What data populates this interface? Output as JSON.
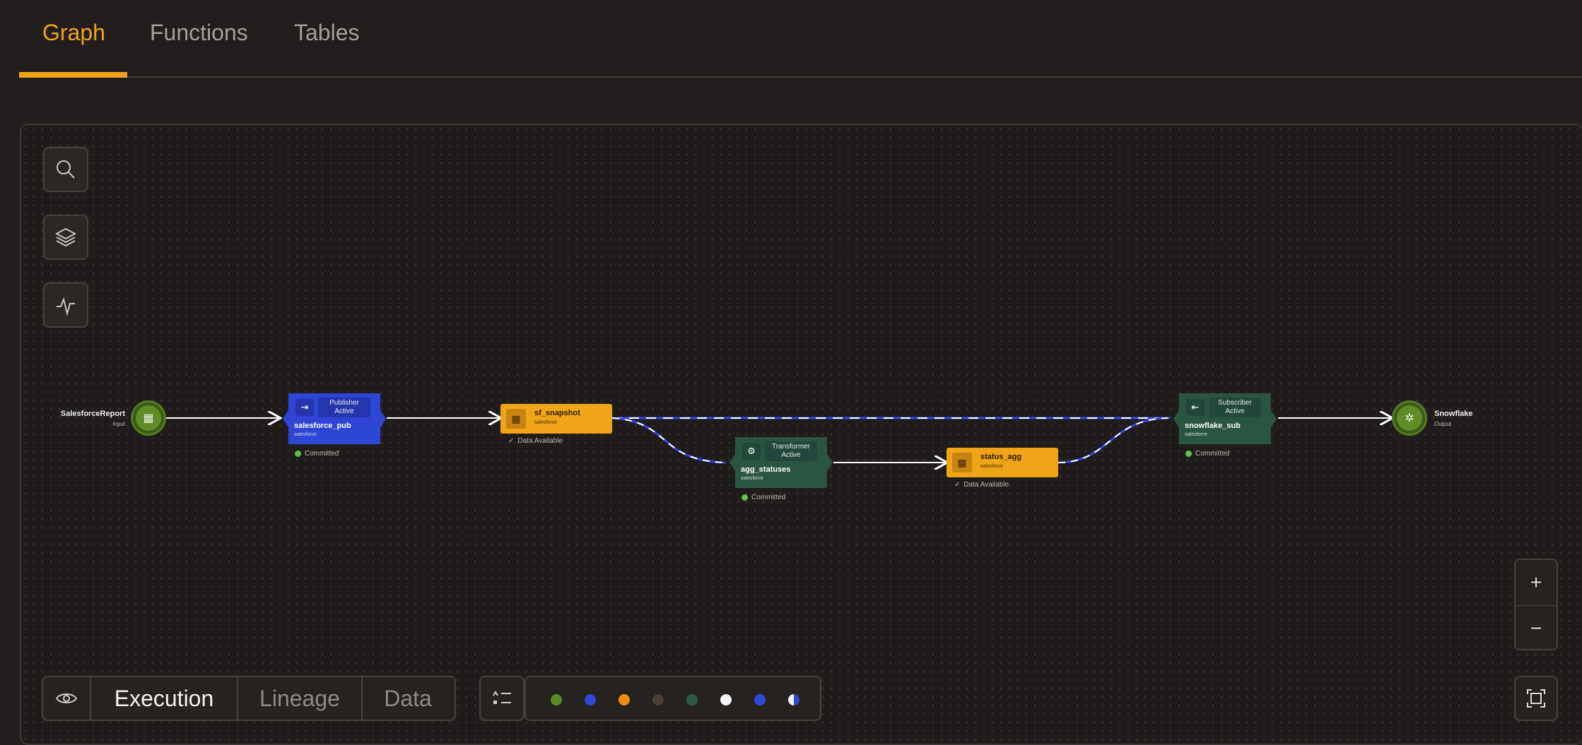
{
  "tabs": [
    {
      "label": "Graph",
      "active": true
    },
    {
      "label": "Functions",
      "active": false
    },
    {
      "label": "Tables",
      "active": false
    }
  ],
  "toolbar": {
    "icons": [
      "search-icon",
      "layers-icon",
      "activity-icon"
    ]
  },
  "graph": {
    "source": {
      "label": "SalesforceReport",
      "sub": "Input",
      "icon": "building-icon"
    },
    "sink": {
      "label": "Snowflake",
      "sub": "Output",
      "icon": "snowflake-icon"
    },
    "publisher": {
      "role": "Publisher Active",
      "name": "salesforce_pub",
      "ns": "salesforce",
      "status": "Committed",
      "color": "#2f45d6"
    },
    "sf_snapshot": {
      "name": "sf_snapshot",
      "ns": "salesforce",
      "status": "Data Available"
    },
    "transformer": {
      "role": "Transformer Active",
      "name": "agg_statuses",
      "ns": "salesforce",
      "status": "Committed",
      "color": "#2c5541"
    },
    "status_agg": {
      "name": "status_agg",
      "ns": "salesforce",
      "status": "Data Available"
    },
    "subscriber": {
      "role": "Subscriber Active",
      "name": "snowflake_sub",
      "ns": "salesforce",
      "status": "Committed",
      "color": "#2c5541"
    }
  },
  "zoom": {
    "in": "+",
    "out": "−"
  },
  "view_modes": [
    {
      "label": "Execution",
      "active": true
    },
    {
      "label": "Lineage",
      "active": false
    },
    {
      "label": "Data",
      "active": false
    }
  ],
  "legend_colors": [
    "#5b8a22",
    "#3247d8",
    "#ee8f10",
    "#4a4034",
    "#2e5a44",
    "#f4f4f4",
    "#3247d8",
    "half-white-blue"
  ]
}
